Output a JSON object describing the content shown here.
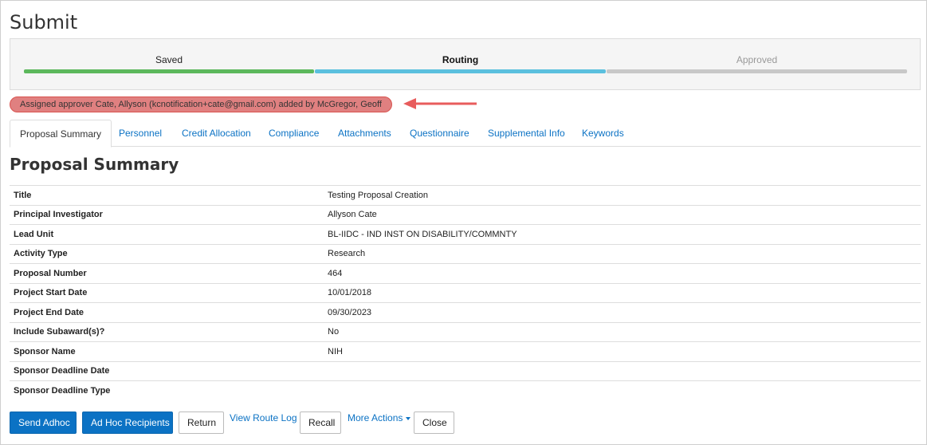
{
  "page": {
    "title": "Submit"
  },
  "progress": {
    "steps": [
      {
        "label": "Saved",
        "state": "complete",
        "color": "#5cb85c"
      },
      {
        "label": "Routing",
        "state": "current",
        "color": "#5bc0de"
      },
      {
        "label": "Approved",
        "state": "pending",
        "color": "#c8c8c8"
      }
    ]
  },
  "alert": {
    "message": "Assigned approver Cate, Allyson (kcnotification+cate@gmail.com) added by McGregor, Geoff",
    "color": "#e08080",
    "arrow_color": "#e85c5c"
  },
  "tabs": [
    {
      "label": "Proposal Summary",
      "active": true
    },
    {
      "label": "Personnel",
      "active": false
    },
    {
      "label": "Credit Allocation",
      "active": false
    },
    {
      "label": "Compliance",
      "active": false
    },
    {
      "label": "Attachments",
      "active": false
    },
    {
      "label": "Questionnaire",
      "active": false
    },
    {
      "label": "Supplemental Info",
      "active": false
    },
    {
      "label": "Keywords",
      "active": false
    }
  ],
  "summary": {
    "title": "Proposal Summary",
    "rows": [
      {
        "label": "Title",
        "value": "Testing Proposal Creation"
      },
      {
        "label": "Principal Investigator",
        "value": "Allyson Cate"
      },
      {
        "label": "Lead Unit",
        "value": "BL-IIDC - IND INST ON DISABILITY/COMMNTY"
      },
      {
        "label": "Activity Type",
        "value": "Research"
      },
      {
        "label": "Proposal Number",
        "value": "464"
      },
      {
        "label": "Project Start Date",
        "value": "10/01/2018"
      },
      {
        "label": "Project End Date",
        "value": "09/30/2023"
      },
      {
        "label": "Include Subaward(s)?",
        "value": "No"
      },
      {
        "label": "Sponsor Name",
        "value": "NIH"
      },
      {
        "label": "Sponsor Deadline Date",
        "value": ""
      },
      {
        "label": "Sponsor Deadline Type",
        "value": ""
      }
    ]
  },
  "actions": {
    "send_adhoc": "Send Adhoc",
    "adhoc_recipients": "Ad Hoc Recipients",
    "return": "Return",
    "view_route_log": "View Route Log",
    "recall": "Recall",
    "more_actions": "More Actions",
    "close": "Close"
  },
  "colors": {
    "primary": "#0b72c4",
    "link": "#0b72c4"
  }
}
